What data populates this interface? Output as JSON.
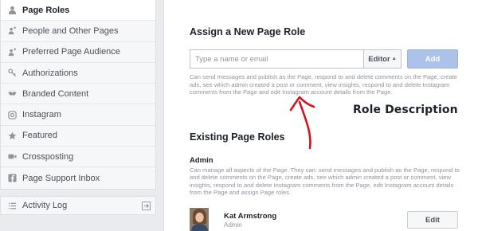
{
  "sidebar": {
    "items": [
      {
        "label": "Page Roles",
        "icon": "user-icon",
        "active": true
      },
      {
        "label": "People and Other Pages",
        "icon": "people-icon",
        "active": false
      },
      {
        "label": "Preferred Page Audience",
        "icon": "audience-icon",
        "active": false
      },
      {
        "label": "Authorizations",
        "icon": "key-icon",
        "active": false
      },
      {
        "label": "Branded Content",
        "icon": "handshake-icon",
        "active": false
      },
      {
        "label": "Instagram",
        "icon": "instagram-icon",
        "active": false
      },
      {
        "label": "Featured",
        "icon": "star-icon",
        "active": false
      },
      {
        "label": "Crossposting",
        "icon": "video-camera-icon",
        "active": false
      },
      {
        "label": "Page Support Inbox",
        "icon": "facebook-icon",
        "active": false
      }
    ],
    "activity_log": "Activity Log"
  },
  "assign": {
    "heading": "Assign a New Page Role",
    "input_placeholder": "Type a name or email",
    "role_selected": "Editor",
    "add_label": "Add",
    "role_description": "Can send messages and publish as the Page, respond to and delete comments on the Page, create ads, see which admin created a post or comment, view insights, respond to and delete Instagram comments from the Page and edit Instagram account details from the Page."
  },
  "annotation": {
    "text": "Role Description",
    "color": "#d0151c"
  },
  "existing": {
    "heading": "Existing Page Roles",
    "role_name": "Admin",
    "role_description": "Can manage all aspects of the Page. They can: send messages and publish as the Page, respond to and delete comments on the Page, create ads, see which admin created a post or comment, view insights, respond to and delete Instagram comments from the Page, edit Instagram account details from the Page and assign Page roles.",
    "people": [
      {
        "name": "Kat Armstrong",
        "role": "Admin",
        "edit_label": "Edit"
      }
    ]
  },
  "colors": {
    "accent_button": "#adc2ea",
    "muted_text": "#90949c",
    "background": "#e9ebee"
  }
}
